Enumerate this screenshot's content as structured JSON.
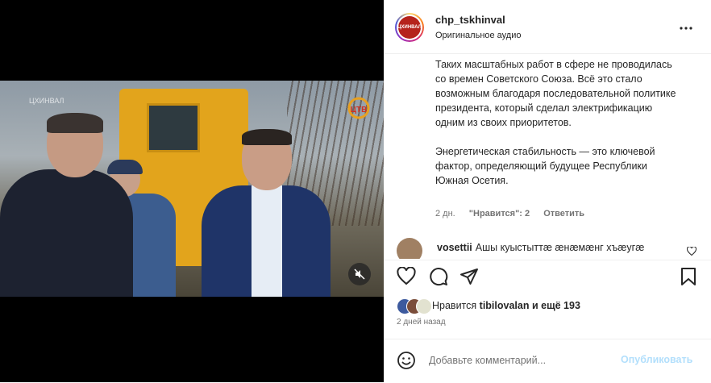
{
  "post": {
    "username": "chp_tskhinval",
    "audio_label": "Оригинальное аудио",
    "avatar_text": "ЦХИНВАЛ"
  },
  "video": {
    "watermark": "ЦХИНВАЛ",
    "channel_logo": "ЦТВ",
    "muted": true
  },
  "caption": {
    "paragraph1": "Таких масштабных работ в сфере не проводилась со времен Советского Союза. Всё это стало возможным благодаря последовательной политике президента, который сделал электрификацию одним из своих приоритетов.",
    "paragraph2": "Энергетическая стабильность — это ключевой фактор, определяющий будущее Республики Южная Осетия.",
    "age": "2 дн.",
    "likes": "\"Нравится\": 2",
    "reply": "Ответить"
  },
  "comments": [
    {
      "username": "vosettii",
      "text": "Ашы куыстыттæ æнæмæнг хъæугæ"
    }
  ],
  "likes_summary": {
    "prefix": "Нравится",
    "user": "tibilovalan",
    "suffix": "и ещё 193"
  },
  "date": "2 дней назад",
  "composer": {
    "placeholder": "Добавьте комментарий...",
    "publish_label": "Опубликовать"
  },
  "colors": {
    "publish_disabled": "#b2dffc",
    "secondary_text": "#737373"
  }
}
